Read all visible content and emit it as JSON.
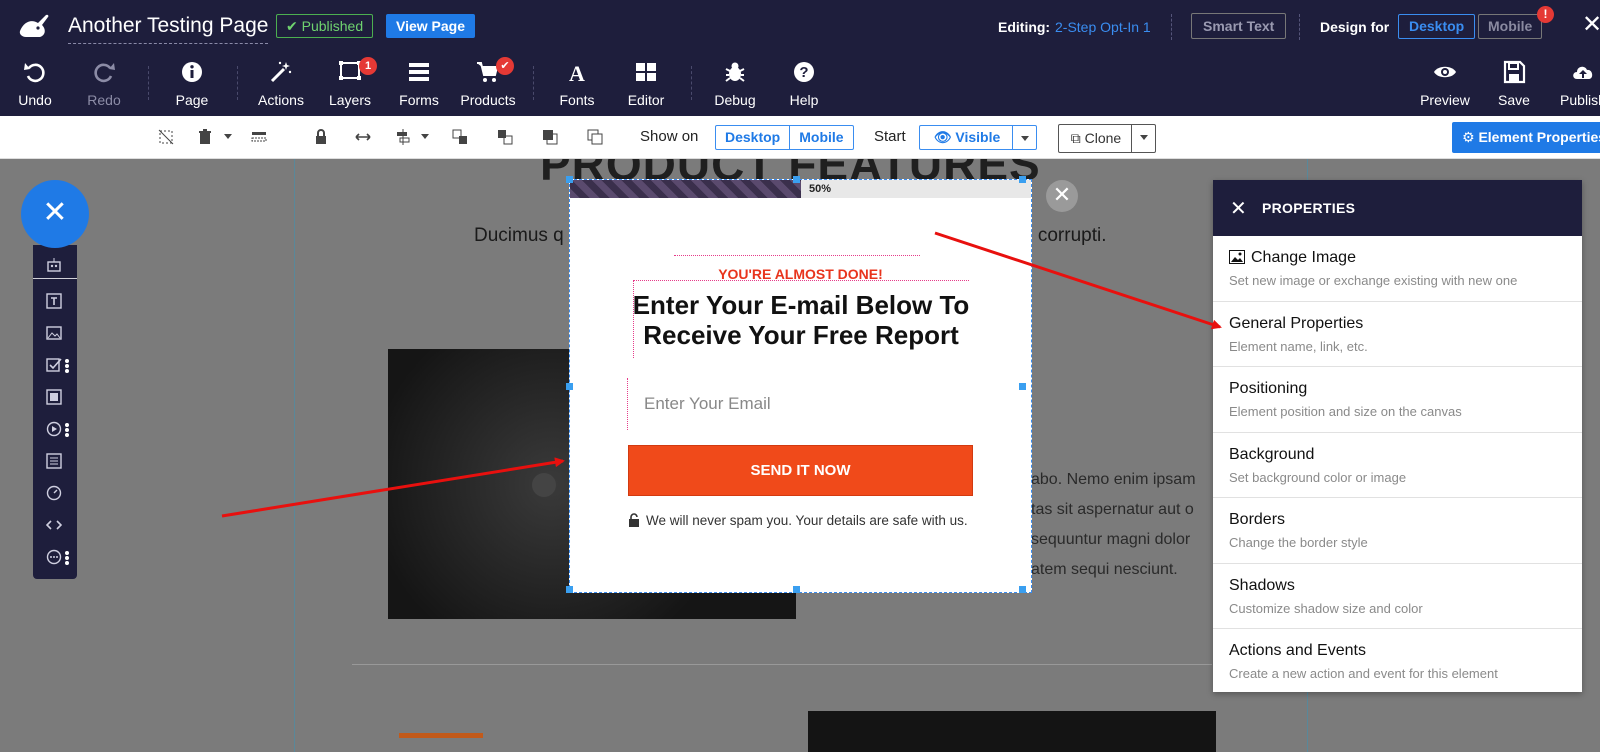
{
  "app": {
    "page_title": "Another Testing Page",
    "status": "Published",
    "view_page": "View Page",
    "editing_label": "Editing:",
    "editing_value": "2-Step Opt-In 1",
    "smart_text": "Smart Text",
    "design_for": "Design for",
    "desktop": "Desktop",
    "mobile": "Mobile",
    "mobile_alert": "!"
  },
  "toolbar": {
    "undo": "Undo",
    "redo": "Redo",
    "page": "Page",
    "actions": "Actions",
    "layers": "Layers",
    "layers_count": "1",
    "forms": "Forms",
    "products": "Products",
    "fonts": "Fonts",
    "editor": "Editor",
    "debug": "Debug",
    "help": "Help",
    "preview": "Preview",
    "save": "Save",
    "publish": "Publish"
  },
  "elembar": {
    "show_on": "Show on",
    "show_desktop": "Desktop",
    "show_mobile": "Mobile",
    "start": "Start",
    "visible": "Visible",
    "clone": "Clone",
    "element_properties": "Element Properties"
  },
  "canvas": {
    "heading": "PRODUCT FEATURES",
    "sub_left": "Ducimus q",
    "sub_right": "e corrupti.",
    "lorem": [
      "abo. Nemo enim ipsam",
      "tas sit aspernatur aut o",
      "sequuntur magni dolor",
      "atem sequi nesciunt."
    ]
  },
  "popup": {
    "progress_label": "50%",
    "progress": 0.5,
    "almost": "YOU'RE ALMOST DONE!",
    "headline_1": "Enter Your E-mail Below To",
    "headline_2": "Receive Your Free Report",
    "email_placeholder": "Enter Your Email",
    "button": "SEND IT NOW",
    "spam": "We will never spam you. Your details are safe with us."
  },
  "properties": {
    "title": "PROPERTIES",
    "items": [
      {
        "title": "Change Image",
        "desc": "Set new image or exchange existing with new one"
      },
      {
        "title": "General Properties",
        "desc": "Element name, link, etc."
      },
      {
        "title": "Positioning",
        "desc": "Element position and size on the canvas"
      },
      {
        "title": "Background",
        "desc": "Set background color or image"
      },
      {
        "title": "Borders",
        "desc": "Change the border style"
      },
      {
        "title": "Shadows",
        "desc": "Customize shadow size and color"
      },
      {
        "title": "Actions and Events",
        "desc": "Create a new action and event for this element"
      }
    ]
  },
  "colors": {
    "navy": "#1e1e3c",
    "accent": "#1f7ae6",
    "cta": "#f04a1a",
    "arrow": "#e8100e"
  }
}
